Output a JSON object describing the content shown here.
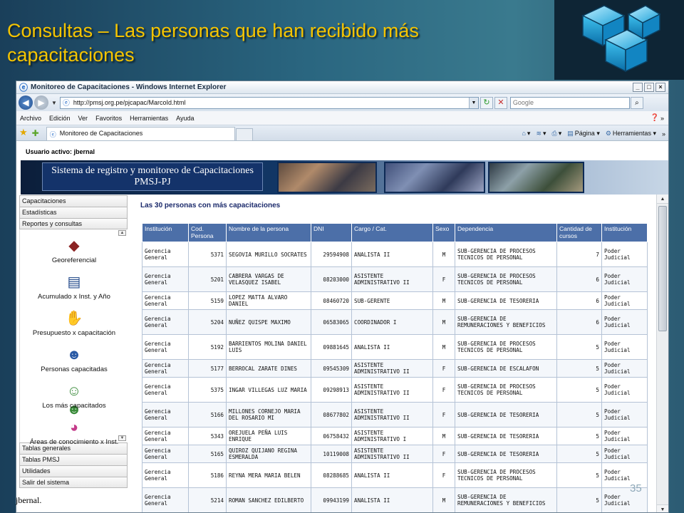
{
  "slide": {
    "title": "Consultas – Las personas que han recibido más capacitaciones",
    "number": "35",
    "footer": "jbernal."
  },
  "browser": {
    "window_title": "Monitoreo de Capacitaciones - Windows Internet Explorer",
    "address": "http://pmsj.org.pe/pjcapac/MarcoId.html",
    "search_placeholder": "Google",
    "menu": [
      "Archivo",
      "Edición",
      "Ver",
      "Favoritos",
      "Herramientas",
      "Ayuda"
    ],
    "tab_label": "Monitoreo de Capacitaciones",
    "cmd_pagina": "Página",
    "cmd_herramientas": "Herramientas"
  },
  "page": {
    "user_line": "Usuario activo: jbernal",
    "banner_title": "Sistema de registro y monitoreo de Capacitaciones PMSJ-PJ",
    "nav_top": [
      "Capacitaciones",
      "Estadísticas",
      "Reportes y consultas"
    ],
    "nav_icons": [
      {
        "label": "Georeferencial",
        "icon": "map-icon"
      },
      {
        "label": "Acumulado x  Inst. y Año",
        "icon": "notebook-icon"
      },
      {
        "label": "Presupuesto x capacitación",
        "icon": "money-icon"
      },
      {
        "label": "Personas capacitadas",
        "icon": "person-icon"
      },
      {
        "label": "Los más capacitados",
        "icon": "people-icon"
      },
      {
        "label": "Áreas de conocimiento x Inst.",
        "icon": "pie-icon"
      }
    ],
    "nav_bottom": [
      "Tablas generales",
      "Tablas PMSJ",
      "Utilidades",
      "Salir del sistema"
    ],
    "content_title": "Las 30 personas con más capacitaciones",
    "table": {
      "headers": [
        "Institución",
        "Cod. Persona",
        "Nombre de la persona",
        "DNI",
        "Cargo / Cat.",
        "Sexo",
        "Dependencia",
        "Cantidad de cursos",
        "Institución"
      ],
      "rows": [
        [
          "Gerencia General",
          "5371",
          "SEGOVIA MURILLO SOCRATES",
          "29594908",
          "ANALISTA II",
          "M",
          "SUB-GERENCIA DE PROCESOS TECNICOS DE PERSONAL",
          "7",
          "Poder Judicial"
        ],
        [
          "Gerencia General",
          "5201",
          "CABRERA VARGAS DE VELASQUEZ ISABEL",
          "08203000",
          "ASISTENTE ADMINISTRATIVO II",
          "F",
          "SUB-GERENCIA DE PROCESOS TECNICOS DE PERSONAL",
          "6",
          "Poder Judicial"
        ],
        [
          "Gerencia General",
          "5159",
          "LOPEZ MATTA ALVARO DANIEL",
          "08460720",
          "SUB-GERENTE",
          "M",
          "SUB-GERENCIA DE TESORERIA",
          "6",
          "Poder Judicial"
        ],
        [
          "Gerencia General",
          "5204",
          "NUÑEZ QUISPE MAXIMO",
          "06583065",
          "COORDINADOR I",
          "M",
          "SUB-GERENCIA DE REMUNERACIONES Y BENEFICIOS",
          "6",
          "Poder Judicial"
        ],
        [
          "Gerencia General",
          "5192",
          "BARRIENTOS MOLINA DANIEL LUIS",
          "09881645",
          "ANALISTA II",
          "M",
          "SUB-GERENCIA DE PROCESOS TECNICOS DE PERSONAL",
          "5",
          "Poder Judicial"
        ],
        [
          "Gerencia General",
          "5177",
          "BERROCAL ZARATE DINES",
          "09545309",
          "ASISTENTE ADMINISTRATIVO II",
          "F",
          "SUB-GERENCIA DE ESCALAFON",
          "5",
          "Poder Judicial"
        ],
        [
          "Gerencia General",
          "5375",
          "INGAR VILLEGAS LUZ MARIA",
          "09298913",
          "ASISTENTE ADMINISTRATIVO II",
          "F",
          "SUB-GERENCIA DE PROCESOS TECNICOS DE PERSONAL",
          "5",
          "Poder Judicial"
        ],
        [
          "Gerencia General",
          "5166",
          "MILLONES CORNEJO MARIA DEL ROSARIO MI",
          "08677802",
          "ASISTENTE ADMINISTRATIVO II",
          "F",
          "SUB-GERENCIA DE TESORERIA",
          "5",
          "Poder Judicial"
        ],
        [
          "Gerencia General",
          "5343",
          "OREJUELA PEÑA LUIS ENRIQUE",
          "06758432",
          "ASISTENTE ADMINISTRATIVO I",
          "M",
          "SUB-GERENCIA DE TESORERIA",
          "5",
          "Poder Judicial"
        ],
        [
          "Gerencia General",
          "5165",
          "QUIROZ QUIJANO REGINA ESMERALDA",
          "10119008",
          "ASISTENTE ADMINISTRATIVO II",
          "F",
          "SUB-GERENCIA DE TESORERIA",
          "5",
          "Poder Judicial"
        ],
        [
          "Gerencia General",
          "5186",
          "REYNA MERA MARIA BELEN",
          "08288685",
          "ANALISTA II",
          "F",
          "SUB-GERENCIA DE PROCESOS TECNICOS DE PERSONAL",
          "5",
          "Poder Judicial"
        ],
        [
          "Gerencia General",
          "5214",
          "ROMAN SANCHEZ EDILBERTO",
          "09943199",
          "ANALISTA II",
          "M",
          "SUB-GERENCIA DE REMUNERACIONES Y BENEFICIOS",
          "5",
          "Poder Judicial"
        ]
      ]
    }
  }
}
